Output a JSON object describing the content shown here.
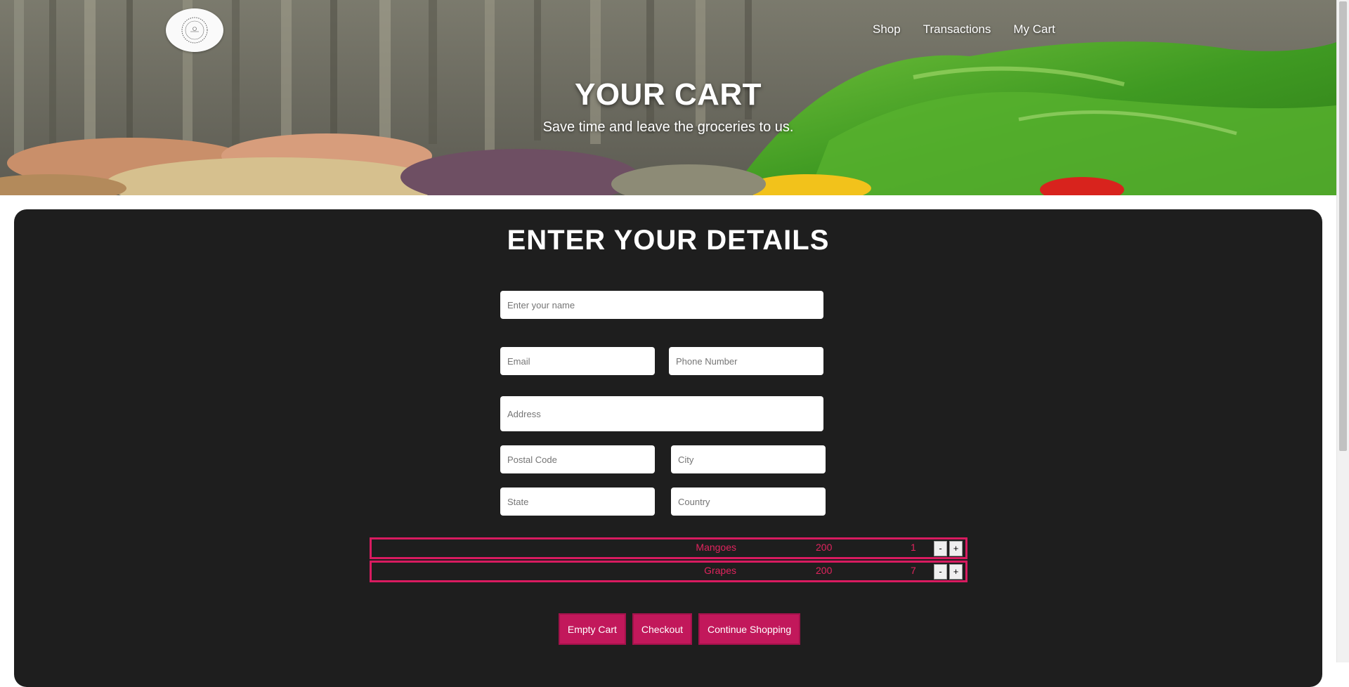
{
  "nav": {
    "logo": "logo-icon",
    "links": [
      "Shop",
      "Transactions",
      "My Cart"
    ]
  },
  "hero": {
    "title": "YOUR CART",
    "subtitle": "Save time and leave the groceries to us."
  },
  "form": {
    "title": "ENTER YOUR DETAILS",
    "name_placeholder": "Enter your name",
    "email_placeholder": "Email",
    "phone_placeholder": "Phone Number",
    "address_placeholder": "Address",
    "postal_placeholder": "Postal Code",
    "city_placeholder": "City",
    "state_placeholder": "State",
    "country_placeholder": "Country"
  },
  "cart": {
    "items": [
      {
        "name": "Mangoes",
        "price": "200",
        "qty": "1"
      },
      {
        "name": "Grapes",
        "price": "200",
        "qty": "7"
      }
    ],
    "minus_label": "-",
    "plus_label": "+"
  },
  "actions": {
    "empty_label": "Empty Cart",
    "checkout_label": "Checkout",
    "continue_label": "Continue Shopping"
  },
  "colors": {
    "accent": "#c2185b",
    "cart_text": "#e0245e",
    "panel": "#1e1e1e"
  }
}
